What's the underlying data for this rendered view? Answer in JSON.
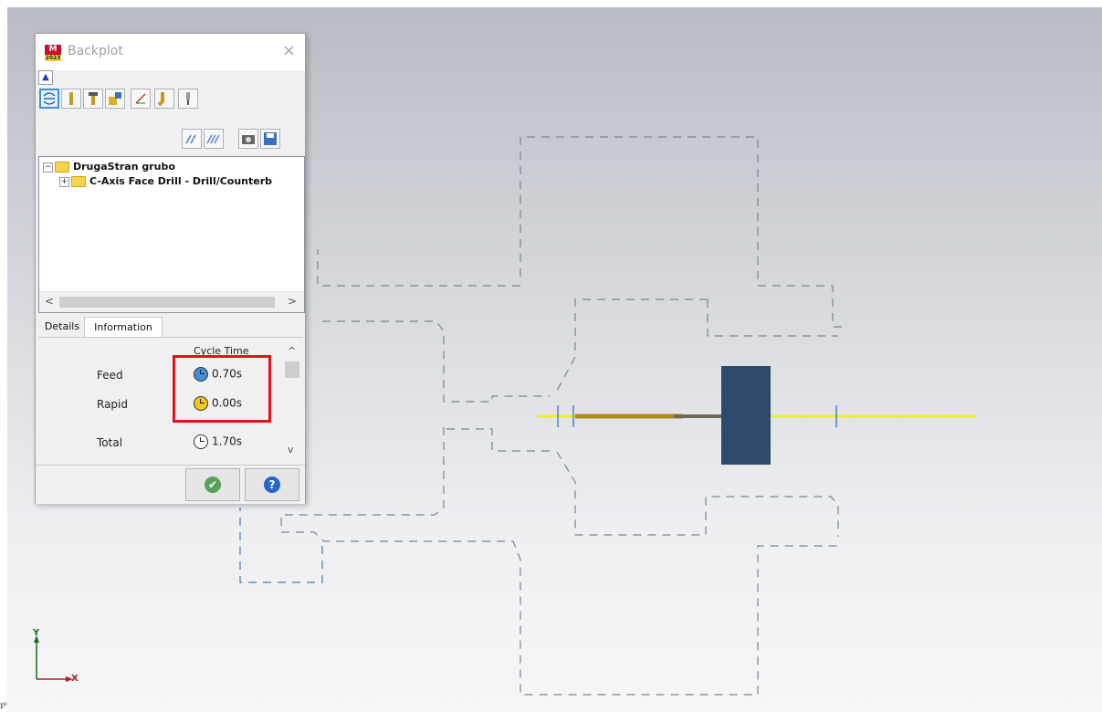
{
  "dialog": {
    "title": "Backplot",
    "logo_text": "M",
    "logo_year": "2023",
    "close_glyph": "×",
    "collapse_glyph": "▲"
  },
  "toolbar": {
    "row1": [
      "display-options-icon",
      "tool-icon",
      "holder-icon",
      "stock-icon",
      "axes-icon",
      "motion-icon",
      "info-icon"
    ],
    "row2": [
      "toolpath-filter-icon",
      "toolpath-pattern-icon",
      "screenshot-icon",
      "save-icon"
    ]
  },
  "tree": {
    "root": "DrugaStran grubo",
    "child": "C-Axis Face Drill - Drill/Counterb",
    "root_expander": "−",
    "child_expander": "+"
  },
  "tabs": {
    "details": "Details",
    "information": "Information"
  },
  "info": {
    "column_header": "Cycle Time",
    "rows": [
      {
        "label": "Feed",
        "value": "0.70s",
        "icon": "feed-clock-icon",
        "color": "#3e8fd8"
      },
      {
        "label": "Rapid",
        "value": "0.00s",
        "icon": "rapid-clock-icon",
        "color": "#f2c51f"
      },
      {
        "label": "Total",
        "value": "1.70s",
        "icon": "total-clock-icon",
        "color": "#ffffff"
      }
    ]
  },
  "buttons": {
    "ok_glyph": "✔",
    "help_glyph": "?"
  },
  "colors": {
    "highlight": "#e3131b",
    "tool_body": "#2d4a6a",
    "toolpath": "#f0ee2a"
  },
  "axes": {
    "x": "X",
    "y": "Y"
  },
  "corner_glyph": "ɪᵖ"
}
